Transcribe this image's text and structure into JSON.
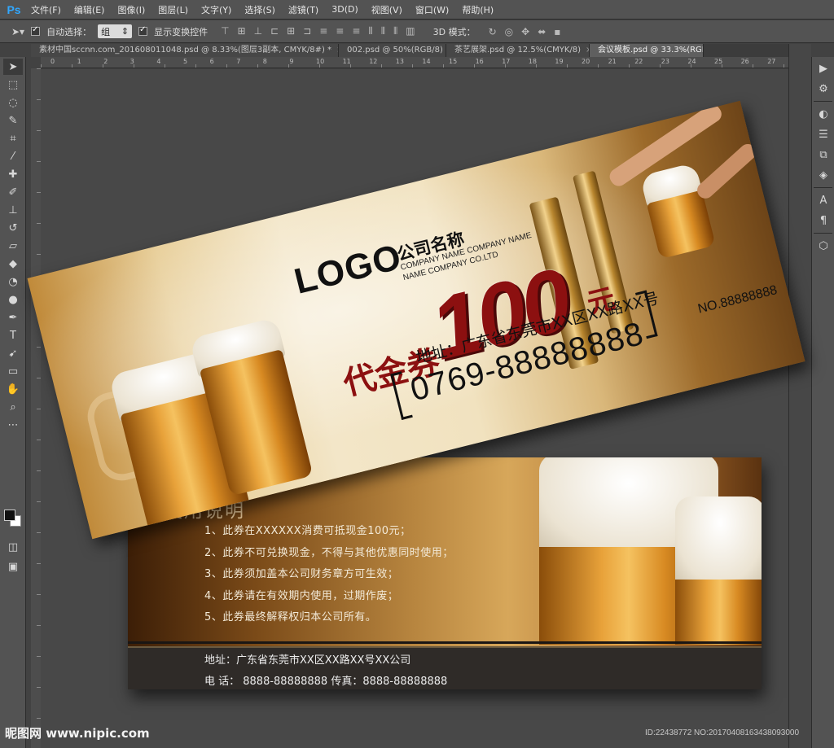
{
  "app": {
    "logo": "Ps"
  },
  "menu": [
    "文件(F)",
    "编辑(E)",
    "图像(I)",
    "图层(L)",
    "文字(Y)",
    "选择(S)",
    "滤镜(T)",
    "3D(D)",
    "视图(V)",
    "窗口(W)",
    "帮助(H)"
  ],
  "options": {
    "auto_select_label": "自动选择：",
    "auto_select_value": "组",
    "show_transform_label": "显示变换控件",
    "mode_3d_label": "3D 模式："
  },
  "tabs": [
    {
      "label": "素材中国sccnn.com_201608011048.psd @ 8.33%(图层3副本, CMYK/8#) *",
      "active": false
    },
    {
      "label": "002.psd @ 50%(RGB/8)",
      "active": false
    },
    {
      "label": "茶艺展架.psd @ 12.5%(CMYK/8)",
      "active": false
    },
    {
      "label": "会议模板.psd @ 33.3%(RGB",
      "active": true
    }
  ],
  "ruler_ticks": [
    "0",
    "1",
    "2",
    "3",
    "4",
    "5",
    "6",
    "7",
    "8",
    "9",
    "10",
    "11",
    "12",
    "13",
    "14",
    "15",
    "16",
    "17",
    "18",
    "19",
    "20",
    "21",
    "22",
    "23",
    "24",
    "25",
    "26",
    "27"
  ],
  "front": {
    "logo": "LOGO",
    "company_cn": "公司名称",
    "company_en_1": "COMPANY NAME COMPANY NAME",
    "company_en_2": "NAME COMPANY CO.LTD",
    "amount": "100",
    "unit": "元",
    "title": "代金券",
    "address": "地址：广东省东莞市XX区XX路XX号",
    "phone": "0769-88888888",
    "serial": "NO.88888888"
  },
  "back": {
    "usage_title": "使用说明",
    "rules": [
      "1、此券在XXXXXX消费可抵现金100元；",
      "2、此券不可兑换现金，不得与其他优惠同时使用；",
      "3、此券须加盖本公司财务章方可生效；",
      "4、此券请在有效期内使用，过期作废；",
      "5、此券最终解释权归本公司所有。"
    ],
    "address": "地址：广东省东莞市XX区XX路XX号XX公司",
    "contact": "电  话：  8888-88888888  传真：8888-88888888"
  },
  "footer": {
    "watermark": "昵图网 www.nipic.com",
    "image_id": "ID:22438772 NO:20170408163438093000"
  },
  "colors": {
    "accent_red": "#8c1010",
    "ps_blue": "#31a8ff"
  }
}
